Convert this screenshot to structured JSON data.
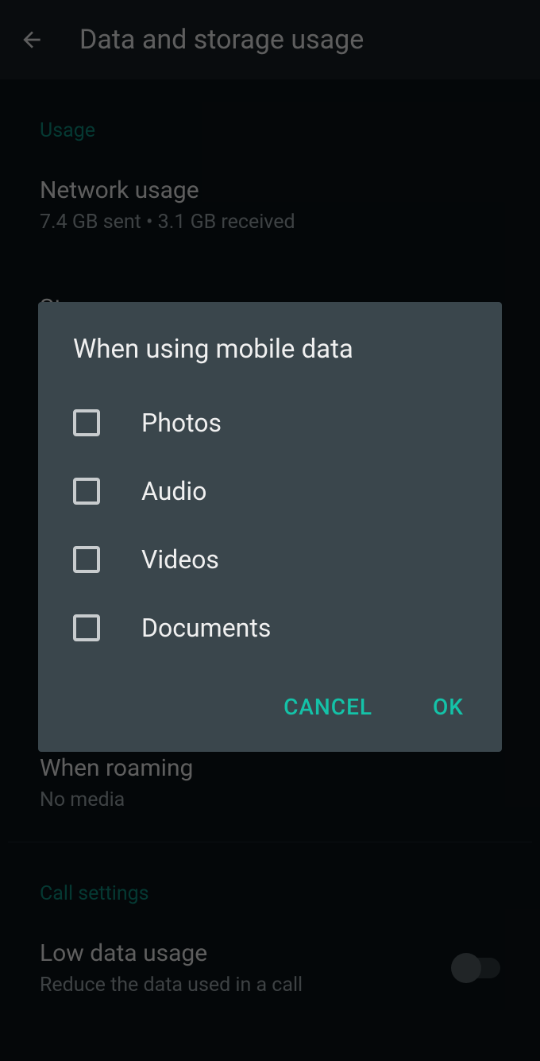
{
  "header": {
    "title": "Data and storage usage"
  },
  "sections": {
    "usage": {
      "header": "Usage",
      "network": {
        "title": "Network usage",
        "subtitle": "7.4 GB sent • 3.1 GB received"
      },
      "storage": {
        "title": "Storage usage"
      }
    },
    "roaming": {
      "title": "When roaming",
      "subtitle": "No media"
    },
    "call": {
      "header": "Call settings",
      "lowdata": {
        "title": "Low data usage",
        "subtitle": "Reduce the data used in a call"
      }
    }
  },
  "dialog": {
    "title": "When using mobile data",
    "options": {
      "photos": "Photos",
      "audio": "Audio",
      "videos": "Videos",
      "documents": "Documents"
    },
    "cancel": "CANCEL",
    "ok": "OK"
  }
}
